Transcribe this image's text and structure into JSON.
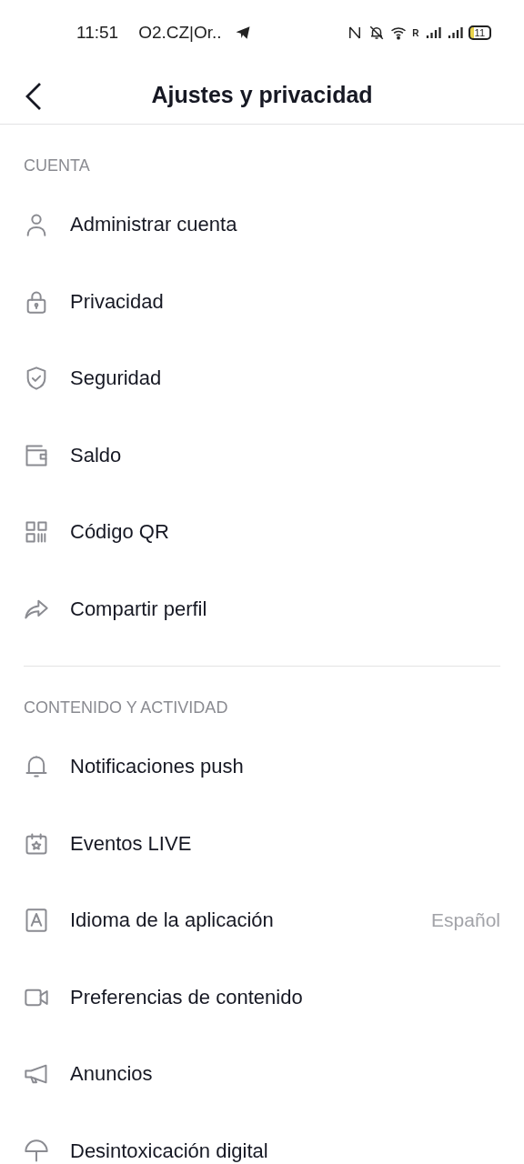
{
  "status_bar": {
    "time": "11:51",
    "carrier": "O2.CZ|Or..",
    "roaming": "R",
    "battery": "11"
  },
  "header": {
    "title": "Ajustes y privacidad"
  },
  "sections": [
    {
      "title": "CUENTA",
      "items": [
        {
          "kind": "person",
          "label": "Administrar cuenta"
        },
        {
          "kind": "lock",
          "label": "Privacidad"
        },
        {
          "kind": "shield",
          "label": "Seguridad"
        },
        {
          "kind": "wallet",
          "label": "Saldo"
        },
        {
          "kind": "qr",
          "label": "Código QR"
        },
        {
          "kind": "share",
          "label": "Compartir perfil"
        }
      ]
    },
    {
      "title": "CONTENIDO Y ACTIVIDAD",
      "items": [
        {
          "kind": "bell",
          "label": "Notificaciones push"
        },
        {
          "kind": "calendar",
          "label": "Eventos LIVE"
        },
        {
          "kind": "language",
          "label": "Idioma de la aplicación",
          "value": "Español"
        },
        {
          "kind": "video",
          "label": "Preferencias de contenido"
        },
        {
          "kind": "megaphone",
          "label": "Anuncios"
        },
        {
          "kind": "umbrella",
          "label": "Desintoxicación digital"
        }
      ]
    }
  ]
}
